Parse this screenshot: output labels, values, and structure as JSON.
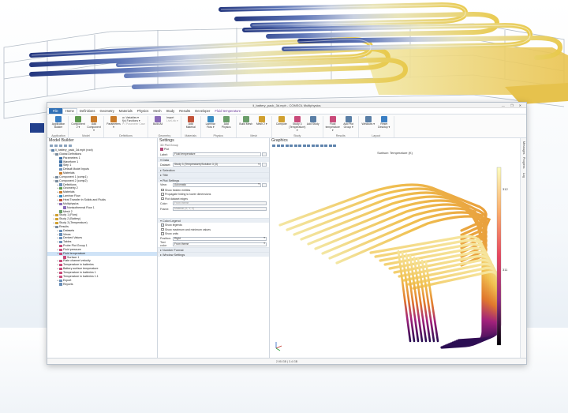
{
  "window": {
    "title": "li_battery_pack_3d.mph - COMSOL Multiphysics",
    "controls": "— ❐ ✕"
  },
  "menu": {
    "items": [
      "File",
      "Home",
      "Definitions",
      "Geometry",
      "Materials",
      "Physics",
      "Mesh",
      "Study",
      "Results",
      "Developer"
    ],
    "contextual": "Fluid temperature"
  },
  "ribbon": {
    "groups": [
      {
        "label": "Application",
        "buttons": [
          "Application Builder"
        ]
      },
      {
        "label": "Model",
        "buttons": [
          "Component 2 ▾",
          "Add Component ▾"
        ]
      },
      {
        "label": "Definitions",
        "buttons": [
          "Parameters ▾"
        ],
        "small": [
          "a= Variables ▾",
          "f(x) Functions ▾",
          "P= Parameter Case"
        ],
        "small_disabled": [
          2
        ]
      },
      {
        "label": "Geometry",
        "buttons": [
          "Build All"
        ],
        "small": [
          "Import",
          "LiveLink ▾"
        ],
        "small_disabled": [
          1
        ]
      },
      {
        "label": "Materials",
        "buttons": [
          "Add Material"
        ]
      },
      {
        "label": "Physics",
        "buttons": [
          "Laminar Flow ▾",
          "Add Physics"
        ]
      },
      {
        "label": "Mesh",
        "buttons": [
          "Build Mesh",
          "Mesh 2 ▾"
        ]
      },
      {
        "label": "Study",
        "buttons": [
          "Compute",
          "Study 3 (Temperature) ▾",
          "Add Study"
        ]
      },
      {
        "label": "Results",
        "buttons": [
          "Fluid temperature ▾",
          "Add Plot Group ▾"
        ]
      },
      {
        "label": "Layout",
        "buttons": [
          "Windows ▾",
          "Reset Desktop ▾"
        ]
      }
    ]
  },
  "model_builder": {
    "title": "Model Builder",
    "nodes": [
      {
        "label": "li_battery_pack_3d.mph (root)",
        "level": 0,
        "tg": "▾",
        "color": "#5a7fa6"
      },
      {
        "label": "Global Definitions",
        "level": 1,
        "tg": "▾",
        "color": "#7a8c9e"
      },
      {
        "label": "Parameters 1",
        "level": 2,
        "tg": "",
        "color": "#3b6ea5"
      },
      {
        "label": "Waveform 1",
        "level": 2,
        "tg": "",
        "color": "#3b6ea5"
      },
      {
        "label": "Step 1",
        "level": 2,
        "tg": "",
        "color": "#3b6ea5"
      },
      {
        "label": "Default Model Inputs",
        "level": 2,
        "tg": "",
        "color": "#6b8fb8"
      },
      {
        "label": "Materials",
        "level": 2,
        "tg": "",
        "color": "#c97b2a"
      },
      {
        "label": "Component 1 (comp1)",
        "level": 1,
        "tg": "▸",
        "color": "#7a8c9e"
      },
      {
        "label": "Component 2 (comp2)",
        "level": 1,
        "tg": "▾",
        "color": "#7a8c9e"
      },
      {
        "label": "Definitions",
        "level": 2,
        "tg": "▸",
        "color": "#6b8fb8"
      },
      {
        "label": "Geometry 2",
        "level": 2,
        "tg": "▸",
        "color": "#5d9a4d"
      },
      {
        "label": "Materials",
        "level": 2,
        "tg": "▸",
        "color": "#c97b2a"
      },
      {
        "label": "Laminar Flow",
        "level": 2,
        "tg": "▸",
        "color": "#3a8cc2"
      },
      {
        "label": "Heat Transfer in Solids and Fluids",
        "level": 2,
        "tg": "▸",
        "color": "#c2543a"
      },
      {
        "label": "Multiphysics",
        "level": 2,
        "tg": "▾",
        "color": "#8a6bb8"
      },
      {
        "label": "Nonisothermal Flow 1",
        "level": 3,
        "tg": "",
        "color": "#8a6bb8"
      },
      {
        "label": "Mesh 2",
        "level": 2,
        "tg": "",
        "color": "#6a9e6a"
      },
      {
        "label": "Study 1 (Flow)",
        "level": 1,
        "tg": "▸",
        "color": "#d0a030"
      },
      {
        "label": "Study 2 (Battery)",
        "level": 1,
        "tg": "▸",
        "color": "#d0a030"
      },
      {
        "label": "Study 3 (Temperature)",
        "level": 1,
        "tg": "▸",
        "color": "#d0a030"
      },
      {
        "label": "Results",
        "level": 1,
        "tg": "▾",
        "color": "#7a8c9e"
      },
      {
        "label": "Datasets",
        "level": 2,
        "tg": "▸",
        "color": "#6b8fb8"
      },
      {
        "label": "Views",
        "level": 2,
        "tg": "▸",
        "color": "#6b8fb8"
      },
      {
        "label": "Derived Values",
        "level": 2,
        "tg": "▸",
        "color": "#6b8fb8"
      },
      {
        "label": "Tables",
        "level": 2,
        "tg": "▸",
        "color": "#6b8fb8"
      },
      {
        "label": "Probe Plot Group 1",
        "level": 2,
        "tg": "",
        "color": "#c94a7a"
      },
      {
        "label": "Fluid pressure",
        "level": 2,
        "tg": "▸",
        "color": "#c94a7a"
      },
      {
        "label": "Fluid temperature",
        "level": 2,
        "tg": "▾",
        "color": "#c94a7a",
        "selected": true
      },
      {
        "label": "Surface 1",
        "level": 3,
        "tg": "",
        "color": "#c94a7a"
      },
      {
        "label": "Plate channel velocity",
        "level": 2,
        "tg": "▸",
        "color": "#c94a7a"
      },
      {
        "label": "Temperature in batteries",
        "level": 2,
        "tg": "▸",
        "color": "#c94a7a"
      },
      {
        "label": "Battery surface temperature",
        "level": 2,
        "tg": "▸",
        "color": "#c94a7a"
      },
      {
        "label": "Temperature in batteries 1",
        "level": 2,
        "tg": "▸",
        "color": "#c94a7a"
      },
      {
        "label": "Temperature in batteries 1.1",
        "level": 2,
        "tg": "▸",
        "color": "#c94a7a"
      },
      {
        "label": "Export",
        "level": 2,
        "tg": "▸",
        "color": "#6b8fb8"
      },
      {
        "label": "Reports",
        "level": 2,
        "tg": "",
        "color": "#6b8fb8"
      }
    ]
  },
  "settings": {
    "title": "Settings",
    "subtitle": "3D Plot Group",
    "plot_button": "Plot",
    "label_caption": "Label:",
    "label_value": "Fluid temperature",
    "sections": {
      "data": "Data",
      "selection": "Selection",
      "title": "Title",
      "plot_settings": "Plot Settings",
      "color_legend": "Color Legend",
      "number_format": "Number Format",
      "window_settings": "Window Settings"
    },
    "dataset_caption": "Dataset:",
    "dataset_value": "Study 3 (Temperature)/Solution 3 (3)",
    "view_caption": "View:",
    "view_value": "Automatic",
    "checkboxes_plot": [
      {
        "label": "Show hidden entities",
        "checked": false
      },
      {
        "label": "Propagate hiding to lower dimensions",
        "checked": false
      },
      {
        "label": "Plot dataset edges",
        "checked": false
      }
    ],
    "color_caption": "Color:",
    "color_value": "From theme",
    "frame_caption": "Frame:",
    "frame_value": "Material  (X, Y, Z)",
    "checkboxes_legend": [
      {
        "label": "Show legends",
        "checked": true
      },
      {
        "label": "Show maximum and minimum values",
        "checked": false
      },
      {
        "label": "Show units",
        "checked": false
      }
    ],
    "position_caption": "Position:",
    "position_value": "Right",
    "text_color_caption": "Text color:",
    "text_color_value": "From theme"
  },
  "graphics": {
    "title": "Graphics",
    "plot_title": "Surface: Temperature (K)",
    "vertical_tabs": [
      "Messages",
      "Progress",
      "Log"
    ],
    "colorbar_labels": [
      "312",
      "311"
    ]
  },
  "status": {
    "memory": "2.95 GB | 3.4 GB"
  }
}
